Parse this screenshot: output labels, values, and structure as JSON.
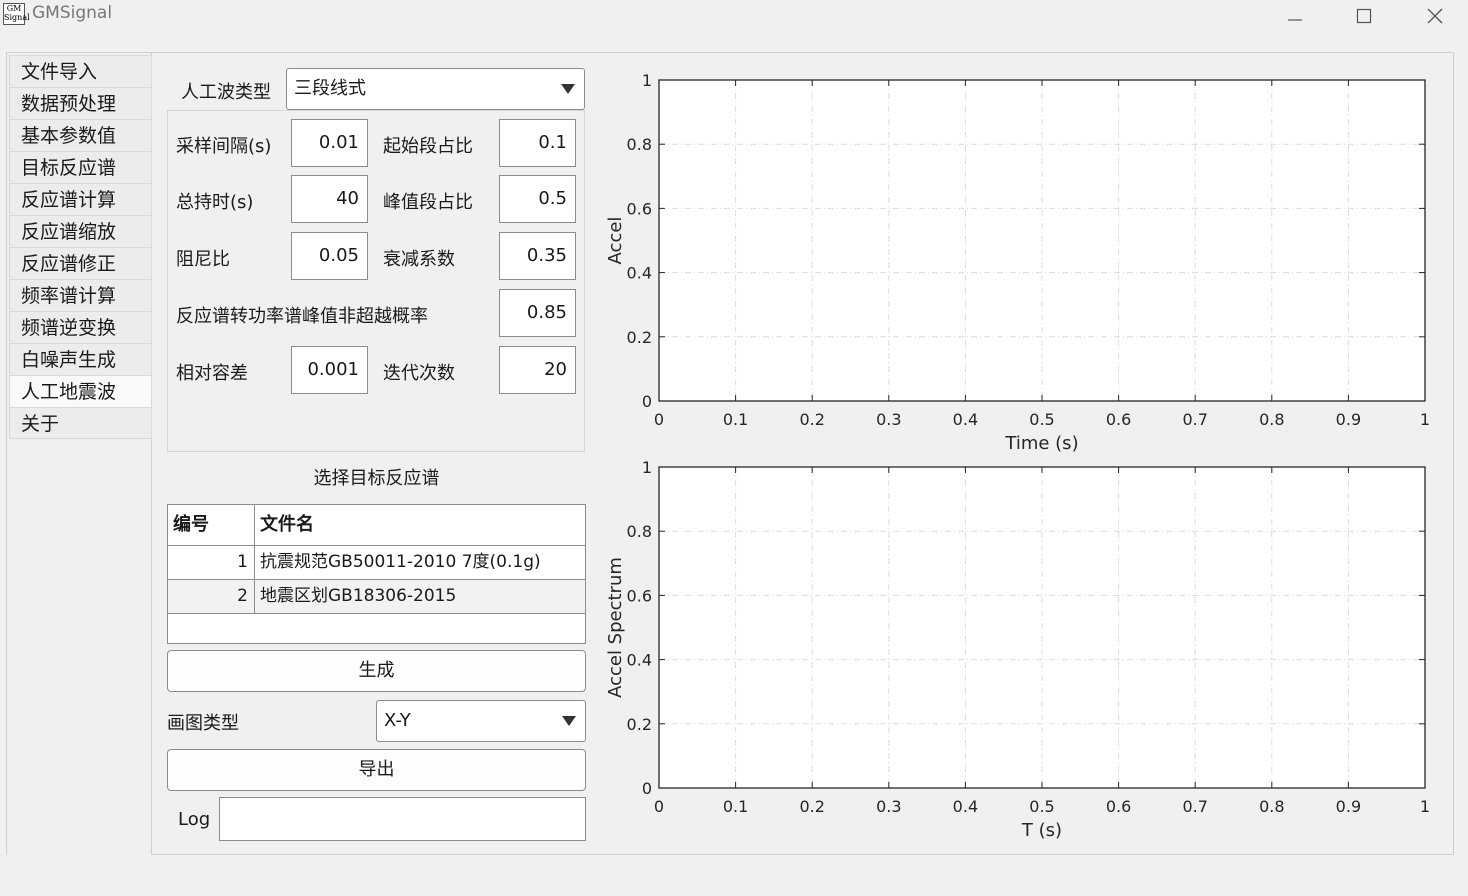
{
  "window": {
    "icon_text": "GM Signal",
    "title": "GMSignal",
    "controls": [
      "minimize-icon",
      "maximize-icon",
      "close-icon"
    ]
  },
  "sidebar": {
    "items": [
      {
        "label": "文件导入"
      },
      {
        "label": "数据预处理"
      },
      {
        "label": "基本参数值"
      },
      {
        "label": "目标反应谱"
      },
      {
        "label": "反应谱计算"
      },
      {
        "label": "反应谱缩放"
      },
      {
        "label": "反应谱修正"
      },
      {
        "label": "频率谱计算"
      },
      {
        "label": "频谱逆变换"
      },
      {
        "label": "白噪声生成"
      },
      {
        "label": "人工地震波",
        "active": true
      },
      {
        "label": "关于"
      }
    ]
  },
  "params": {
    "wave_type_label": "人工波类型",
    "wave_type_value": "三段线式",
    "sample_interval_label": "采样间隔(s)",
    "sample_interval_value": "0.01",
    "start_ratio_label": "起始段占比",
    "start_ratio_value": "0.1",
    "duration_label": "总持时(s)",
    "duration_value": "40",
    "peak_ratio_label": "峰值段占比",
    "peak_ratio_value": "0.5",
    "damping_label": "阻尼比",
    "damping_value": "0.05",
    "decay_label": "衰减系数",
    "decay_value": "0.35",
    "nonexceed_label": "反应谱转功率谱峰值非超越概率",
    "nonexceed_value": "0.85",
    "tolerance_label": "相对容差",
    "tolerance_value": "0.001",
    "iterations_label": "迭代次数",
    "iterations_value": "20"
  },
  "target_spectrum": {
    "section_title": "选择目标反应谱",
    "columns": [
      "编号",
      "文件名"
    ],
    "rows": [
      {
        "id": "1",
        "name": "抗震规范GB50011-2010 7度(0.1g)"
      },
      {
        "id": "2",
        "name": "地震区划GB18306-2015"
      }
    ]
  },
  "actions": {
    "generate_label": "生成",
    "plot_type_label": "画图类型",
    "plot_type_value": "X-Y",
    "export_label": "导出",
    "log_label": "Log",
    "log_value": ""
  },
  "chart_data": [
    {
      "type": "line",
      "xlabel": "Time (s)",
      "ylabel": "Accel",
      "xlim": [
        0,
        1
      ],
      "ylim": [
        0,
        1
      ],
      "xticks": [
        "0",
        "0.1",
        "0.2",
        "0.3",
        "0.4",
        "0.5",
        "0.6",
        "0.7",
        "0.8",
        "0.9",
        "1"
      ],
      "yticks": [
        "0",
        "0.2",
        "0.4",
        "0.6",
        "0.8",
        "1"
      ],
      "grid": true,
      "series": []
    },
    {
      "type": "line",
      "xlabel": "T (s)",
      "ylabel": "Accel Spectrum",
      "xlim": [
        0,
        1
      ],
      "ylim": [
        0,
        1
      ],
      "xticks": [
        "0",
        "0.1",
        "0.2",
        "0.3",
        "0.4",
        "0.5",
        "0.6",
        "0.7",
        "0.8",
        "0.9",
        "1"
      ],
      "yticks": [
        "0",
        "0.2",
        "0.4",
        "0.6",
        "0.8",
        "1"
      ],
      "grid": true,
      "series": []
    }
  ]
}
